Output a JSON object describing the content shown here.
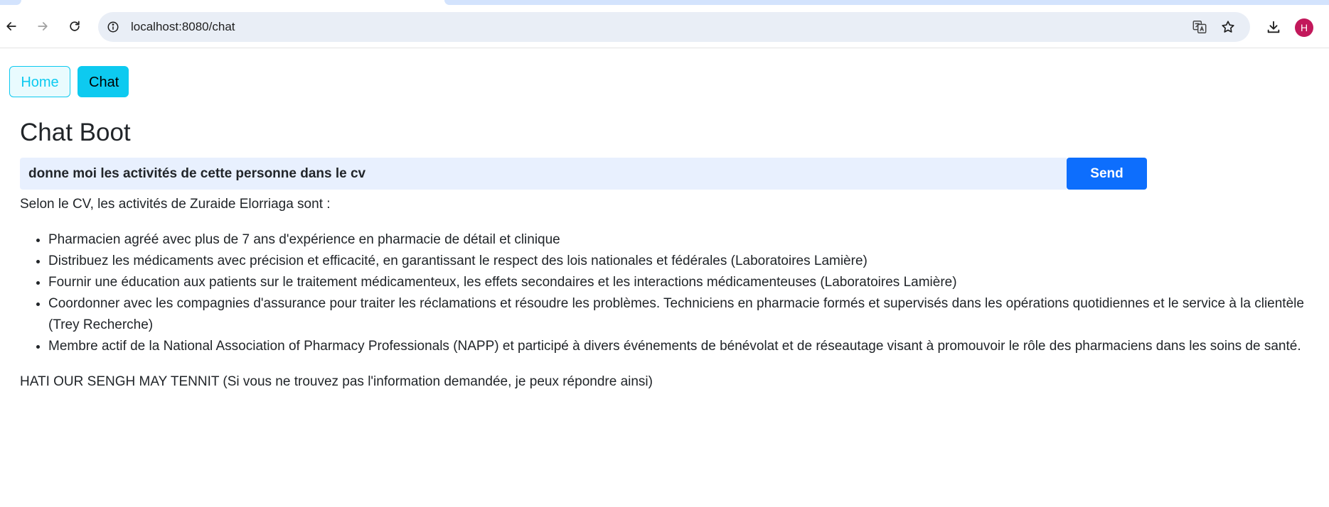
{
  "browser": {
    "url": "localhost:8080/chat",
    "avatar_initial": "H",
    "icons": {
      "back": "arrow-left-icon",
      "forward": "arrow-right-icon",
      "reload": "reload-icon",
      "site_info": "info-icon",
      "translate": "translate-icon",
      "bookmark": "star-icon",
      "downloads": "download-icon"
    }
  },
  "nav": {
    "home_label": "Home",
    "chat_label": "Chat"
  },
  "page": {
    "title": "Chat Boot"
  },
  "chat": {
    "input_value": "donne moi les activités de cette personne dans le cv",
    "send_label": "Send",
    "response": {
      "intro": "Selon le CV, les activités de Zuraide Elorriaga sont :",
      "items": [
        "Pharmacien agréé avec plus de 7 ans d'expérience en pharmacie de détail et clinique",
        "Distribuez les médicaments avec précision et efficacité, en garantissant le respect des lois nationales et fédérales (Laboratoires Lamière)",
        "Fournir une éducation aux patients sur le traitement médicamenteux, les effets secondaires et les interactions médicamenteuses (Laboratoires Lamière)",
        "Coordonner avec les compagnies d'assurance pour traiter les réclamations et résoudre les problèmes. Techniciens en pharmacie formés et supervisés dans les opérations quotidiennes et le service à la clientèle (Trey Recherche)",
        "Membre actif de la National Association of Pharmacy Professionals (NAPP) et participé à divers événements de bénévolat et de réseautage visant à promouvoir le rôle des pharmaciens dans les soins de santé."
      ],
      "footer": "HATI OUR SENGH MAY TENNIT (Si vous ne trouvez pas l'information demandée, je peux répondre ainsi)"
    }
  },
  "colors": {
    "accent_info": "#0dcaf0",
    "primary_button": "#0d6efd",
    "input_bg": "#e8f0fe",
    "omnibox_bg": "#e9eef6",
    "avatar_bg": "#c2185b"
  }
}
